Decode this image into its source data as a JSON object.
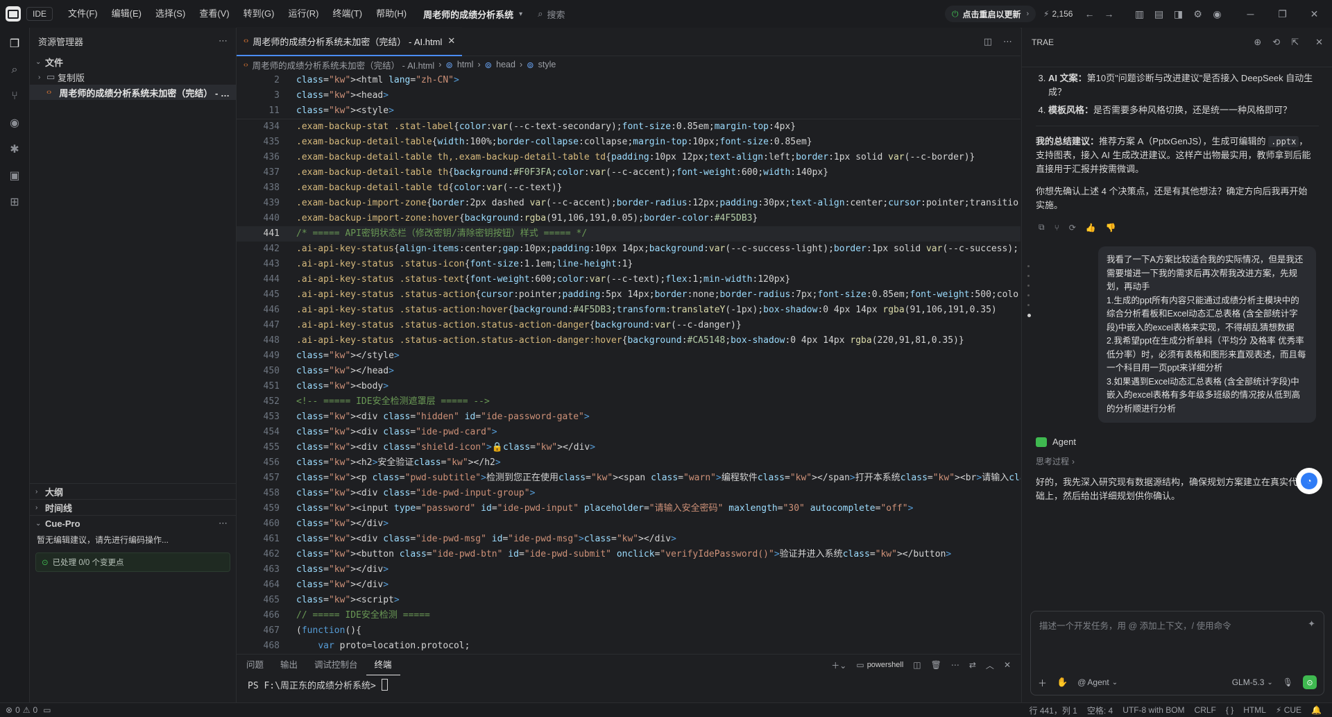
{
  "titlebar": {
    "app_badge": "IDE",
    "menus": [
      "文件(F)",
      "编辑(E)",
      "选择(S)",
      "查看(V)",
      "转到(G)",
      "运行(R)",
      "终端(T)",
      "帮助(H)"
    ],
    "project": "周老师的成绩分析系统",
    "search_placeholder": "搜索",
    "update_label": "点击重启以更新",
    "count": "2,156"
  },
  "sidebar": {
    "title": "资源管理器",
    "section_files": "文件",
    "folder": "复制版",
    "file": "周老师的成绩分析系统未加密（完结） - AI.html",
    "section_outline": "大纲",
    "section_timeline": "时间线",
    "section_cue": "Cue-Pro",
    "cue_hint": "暂无编辑建议，请先进行编码操作...",
    "cue_status": "已处理 0/0 个变更点"
  },
  "editor": {
    "tab_label": "周老师的成绩分析系统未加密（完结） - AI.html",
    "breadcrumb": [
      "周老师的成绩分析系统未加密（完结） - AI.html",
      "html",
      "head",
      "style"
    ],
    "lines": [
      {
        "n": "2",
        "t": "<html lang=\"zh-CN\">"
      },
      {
        "n": "3",
        "t": "<head>"
      },
      {
        "n": "11",
        "t": "<style>"
      },
      {
        "n": "434",
        "t": ".exam-backup-stat .stat-label{color:var(--c-text-secondary);font-size:0.85em;margin-top:4px}"
      },
      {
        "n": "435",
        "t": ".exam-backup-detail-table{width:100%;border-collapse:collapse;margin-top:10px;font-size:0.85em}"
      },
      {
        "n": "436",
        "t": ".exam-backup-detail-table th,.exam-backup-detail-table td{padding:10px 12px;text-align:left;border:1px solid var(--c-border)}"
      },
      {
        "n": "437",
        "t": ".exam-backup-detail-table th{background:#F0F3FA;color:var(--c-accent);font-weight:600;width:140px}"
      },
      {
        "n": "438",
        "t": ".exam-backup-detail-table td{color:var(--c-text)}"
      },
      {
        "n": "439",
        "t": ".exam-backup-import-zone{border:2px dashed var(--c-accent);border-radius:12px;padding:30px;text-align:center;cursor:pointer;transitio"
      },
      {
        "n": "440",
        "t": ".exam-backup-import-zone:hover{background:rgba(91,106,191,0.05);border-color:#4F5DB3}"
      },
      {
        "n": "441",
        "t": "/* ===== API密钥状态栏（修改密钥/清除密钥按钮）样式 ===== */"
      },
      {
        "n": "442",
        "t": ".ai-api-key-status{align-items:center;gap:10px;padding:10px 14px;background:var(--c-success-light);border:1px solid var(--c-success);"
      },
      {
        "n": "443",
        "t": ".ai-api-key-status .status-icon{font-size:1.1em;line-height:1}"
      },
      {
        "n": "444",
        "t": ".ai-api-key-status .status-text{font-weight:600;color:var(--c-text);flex:1;min-width:120px}"
      },
      {
        "n": "445",
        "t": ".ai-api-key-status .status-action{cursor:pointer;padding:5px 14px;border:none;border-radius:7px;font-size:0.85em;font-weight:500;colo"
      },
      {
        "n": "446",
        "t": ".ai-api-key-status .status-action:hover{background:#4F5DB3;transform:translateY(-1px);box-shadow:0 4px 14px rgba(91,106,191,0.35)"
      },
      {
        "n": "447",
        "t": ".ai-api-key-status .status-action.status-action-danger{background:var(--c-danger)}"
      },
      {
        "n": "448",
        "t": ".ai-api-key-status .status-action.status-action-danger:hover{background:#CA5148;box-shadow:0 4px 14px rgba(220,91,81,0.35)}"
      },
      {
        "n": "449",
        "t": "</style>"
      },
      {
        "n": "450",
        "t": "</head>"
      },
      {
        "n": "451",
        "t": "<body>"
      },
      {
        "n": "452",
        "t": "<!-- ===== IDE安全检测遮罩层 ===== -->"
      },
      {
        "n": "453",
        "t": "<div class=\"hidden\" id=\"ide-password-gate\">"
      },
      {
        "n": "454",
        "t": "<div class=\"ide-pwd-card\">"
      },
      {
        "n": "455",
        "t": "<div class=\"shield-icon\">🔒</div>"
      },
      {
        "n": "456",
        "t": "<h2>安全验证</h2>"
      },
      {
        "n": "457",
        "t": "<p class=\"pwd-subtitle\">检测到您正在使用<span class=\"warn\">编程软件</span>打开本系统<br>请输入<span class=\"warn\">高安全性密码</span>后方可继"
      },
      {
        "n": "458",
        "t": "<div class=\"ide-pwd-input-group\">"
      },
      {
        "n": "459",
        "t": "<input type=\"password\" id=\"ide-pwd-input\" placeholder=\"请输入安全密码\" maxlength=\"30\" autocomplete=\"off\">"
      },
      {
        "n": "460",
        "t": "</div>"
      },
      {
        "n": "461",
        "t": "<div class=\"ide-pwd-msg\" id=\"ide-pwd-msg\"></div>"
      },
      {
        "n": "462",
        "t": "<button class=\"ide-pwd-btn\" id=\"ide-pwd-submit\" onclick=\"verifyIdePassword()\">验证并进入系统</button>"
      },
      {
        "n": "463",
        "t": "</div>"
      },
      {
        "n": "464",
        "t": "</div>"
      },
      {
        "n": "465",
        "t": "<script>"
      },
      {
        "n": "466",
        "t": "// ===== IDE安全检测 ====="
      },
      {
        "n": "467",
        "t": "(function(){"
      },
      {
        "n": "468",
        "t": "    var proto=location.protocol;"
      }
    ]
  },
  "panel": {
    "tabs": [
      "问题",
      "输出",
      "调试控制台",
      "终端"
    ],
    "shell": "powershell",
    "prompt": "PS F:\\周正东的成绩分析系统> "
  },
  "chat": {
    "title": "TRAE",
    "list_item_3_label": "AI 文案：",
    "list_item_3": "第10页\"问题诊断与改进建议\"是否接入 DeepSeek 自动生成？",
    "list_item_4_label": "模板风格：",
    "list_item_4": "是否需要多种风格切换，还是统一一种风格即可？",
    "summary_label": "我的总结建议：",
    "summary_pre": "推荐方案 A（PptxGenJS），生成可编辑的 ",
    "summary_code": ".pptx",
    "summary_post": "，支持图表，接入 AI 生成改进建议。这样产出物最实用，教师拿到后能直接用于汇报并按需微调。",
    "question": "你想先确认上述 4 个决策点，还是有其他想法？确定方向后我再开始实施。",
    "user_msg": "我看了一下A方案比较适合我的实际情况，但是我还需要增进一下我的需求后再次帮我改进方案，先规划，再动手\n1.生成的ppt所有内容只能通过成绩分析主模块中的综合分析看板和Excel动态汇总表格 (含全部统计字段)中嵌入的excel表格来实现，不得胡乱猜想数据\n2.我希望ppt在生成分析单科（平均分 及格率 优秀率 低分率）时，必须有表格和图形来直观表述，而且每一个科目用一页ppt来详细分析\n3.如果遇到Excel动态汇总表格 (含全部统计字段)中嵌入的excel表格有多年级多班级的情况按从低到高的分析顺进行分析",
    "agent_label": "Agent",
    "thinking": "思考过程",
    "agent_reply": "好的，我先深入研究现有数据源结构，确保规划方案建立在真实代码基础上，然后给出详细规划供你确认。",
    "input_placeholder": "描述一个开发任务，用 @ 添加上下文，/ 使用命令",
    "agent_select": "Agent",
    "model": "GLM-5.3"
  },
  "statusbar": {
    "errors": "0",
    "warnings": "0",
    "position": "行 441，列 1",
    "spaces": "空格: 4",
    "encoding": "UTF-8 with BOM",
    "eol": "CRLF",
    "braces": "{ }",
    "language": "HTML",
    "cue": "CUE"
  }
}
